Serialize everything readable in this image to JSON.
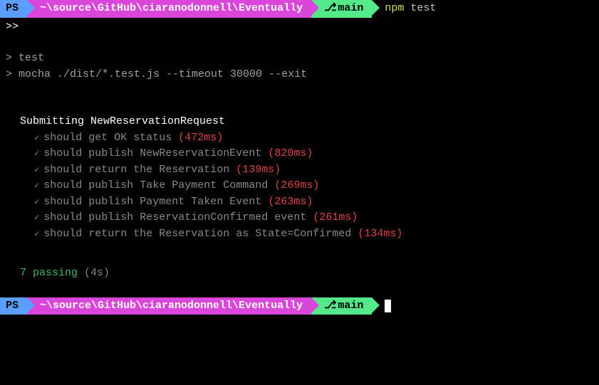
{
  "prompt": {
    "ps": "PS",
    "path": "~\\source\\GitHub\\ciaranodonnell\\Eventually",
    "branch_icon": "⎇",
    "branch": "main",
    "command_npm": "npm",
    "command_args": "test"
  },
  "output": {
    "cont_prompt": ">>",
    "script_header": "> test",
    "script_cmd": "> mocha ./dist/*.test.js --timeout 30000 --exit"
  },
  "suite": {
    "name": "Submitting NewReservationRequest",
    "tests": [
      {
        "desc": "should get OK status",
        "time": "(472ms)"
      },
      {
        "desc": "should publish NewReservationEvent",
        "time": "(820ms)"
      },
      {
        "desc": "should return the Reservation",
        "time": "(139ms)"
      },
      {
        "desc": "should publish Take Payment Command",
        "time": "(269ms)"
      },
      {
        "desc": "should publish Payment Taken Event",
        "time": "(263ms)"
      },
      {
        "desc": "should publish ReservationConfirmed event",
        "time": "(261ms)"
      },
      {
        "desc": "should return the Reservation as State=Confirmed",
        "time": "(134ms)"
      }
    ]
  },
  "summary": {
    "passing": "7 passing",
    "time": "(4s)"
  }
}
